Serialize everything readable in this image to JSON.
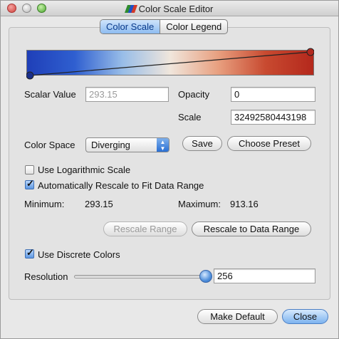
{
  "window": {
    "title": "Color Scale Editor"
  },
  "tabs": [
    {
      "label": "Color Scale",
      "active": true
    },
    {
      "label": "Color Legend",
      "active": false
    }
  ],
  "colormap": {
    "colors": [
      "#1f3fb8",
      "#2f5fd0",
      "#98bde8",
      "#f0e6dc",
      "#e8a080",
      "#c84a30",
      "#b4281c"
    ],
    "left_handle_color": "#1a2f8a",
    "right_handle_color": "#b2291f"
  },
  "scalar_value": {
    "label": "Scalar Value",
    "value": "293.15"
  },
  "opacity": {
    "label": "Opacity",
    "value": "0"
  },
  "scale": {
    "label": "Scale",
    "value": "32492580443198"
  },
  "color_space": {
    "label": "Color Space",
    "selected": "Diverging"
  },
  "buttons": {
    "save": "Save",
    "choose_preset": "Choose Preset",
    "rescale_range": "Rescale Range",
    "rescale_to_data": "Rescale to Data Range",
    "make_default": "Make Default",
    "close": "Close"
  },
  "checkboxes": {
    "logarithmic": {
      "label": "Use Logarithmic Scale",
      "checked": false
    },
    "auto_rescale": {
      "label": "Automatically Rescale to Fit Data Range",
      "checked": true
    },
    "discrete": {
      "label": "Use Discrete Colors",
      "checked": true
    }
  },
  "range": {
    "min_label": "Minimum:",
    "min_value": "293.15",
    "max_label": "Maximum:",
    "max_value": "913.16"
  },
  "resolution": {
    "label": "Resolution",
    "value": "256",
    "slider_fraction": 1.0
  }
}
